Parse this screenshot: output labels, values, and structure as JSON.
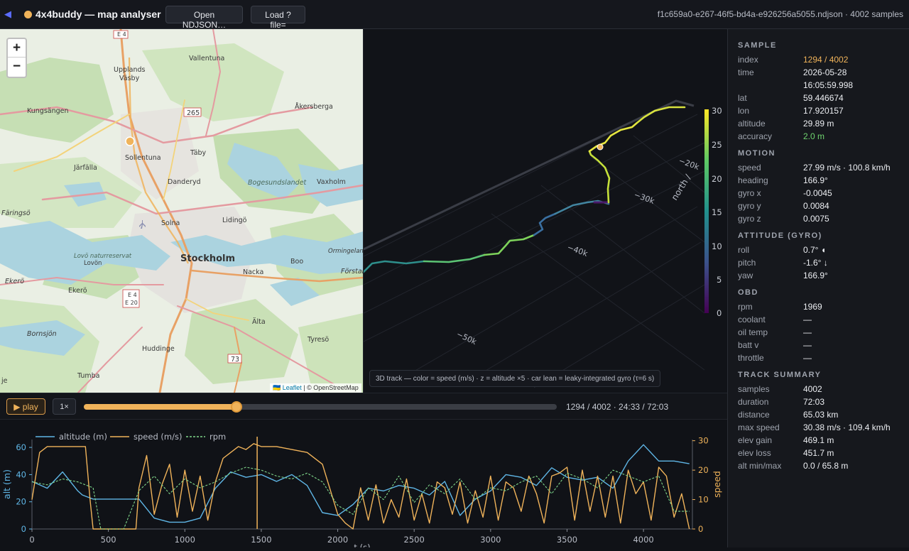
{
  "header": {
    "back_icon": "arrow-left-icon",
    "title": "4x4buddy — map analyser",
    "open_button": "Open NDJSON…",
    "load_button": "Load ?file=",
    "file_info": "f1c659a0-e267-46f5-bd4a-e926256a5055.ndjson · 4002 samples"
  },
  "map": {
    "zoom_in": "+",
    "zoom_out": "−",
    "attribution_flag": "🇺🇦",
    "attribution_link": "Leaflet",
    "attribution_text": "| © OpenStreetMap",
    "labels": [
      {
        "id": "e4-top",
        "text": "E 4"
      },
      {
        "id": "vallentuna",
        "text": "Vallentuna"
      },
      {
        "id": "upplands-vasby",
        "text": "Upplands\nVäsby"
      },
      {
        "id": "kungsangen",
        "text": "Kungsängen"
      },
      {
        "id": "r265",
        "text": "265"
      },
      {
        "id": "akersberga",
        "text": "Åkersberga"
      },
      {
        "id": "sollentuna",
        "text": "Sollentuna"
      },
      {
        "id": "taby",
        "text": "Täby"
      },
      {
        "id": "jarfalla",
        "text": "Järfälla"
      },
      {
        "id": "danderyd",
        "text": "Danderyd"
      },
      {
        "id": "bogesund",
        "text": "Bogesundslandet"
      },
      {
        "id": "vaxholm",
        "text": "Vaxholm"
      },
      {
        "id": "faringso",
        "text": "Färingsö"
      },
      {
        "id": "solna",
        "text": "Solna"
      },
      {
        "id": "lidingo",
        "text": "Lidingö"
      },
      {
        "id": "lovo-nr",
        "text": "Lovö naturreservat"
      },
      {
        "id": "lovon",
        "text": "Lovön"
      },
      {
        "id": "stockholm",
        "text": "Stockholm"
      },
      {
        "id": "ormingelandet",
        "text": "Ormingelandet"
      },
      {
        "id": "forstal",
        "text": "Förstal"
      },
      {
        "id": "nacka",
        "text": "Nacka"
      },
      {
        "id": "boo",
        "text": "Boo"
      },
      {
        "id": "ekero1",
        "text": "Ekerö"
      },
      {
        "id": "ekero2",
        "text": "Ekerö"
      },
      {
        "id": "e4e20",
        "text": "E 4\nE 20"
      },
      {
        "id": "alta",
        "text": "Älta"
      },
      {
        "id": "bornsjon",
        "text": "Bornsjön"
      },
      {
        "id": "tyreso",
        "text": "Tyresö"
      },
      {
        "id": "huddinge",
        "text": "Huddinge"
      },
      {
        "id": "r73",
        "text": "73"
      },
      {
        "id": "tumba",
        "text": "Tumba"
      },
      {
        "id": "je",
        "text": "je"
      }
    ],
    "marker_color": "#f0b35a"
  },
  "plot3d": {
    "caption": "3D track — color = speed (m/s) · z = altitude ×5 · car lean = leaky-integrated gyro (τ=6 s)",
    "north_ticks": [
      "−20k",
      "−30k",
      "−40k",
      "−50k"
    ],
    "north_label": "north /",
    "colorbar_ticks": [
      "30",
      "25",
      "20",
      "15",
      "10",
      "5",
      "0"
    ]
  },
  "playback": {
    "play_icon": "play-triangle-icon",
    "play_label": "play",
    "speed_label": "1×",
    "progress": 0.3233,
    "status": "1294 / 4002 · 24:33 / 72:03"
  },
  "chart_data": {
    "type": "line",
    "legend": [
      "altitude (m)",
      "speed (m/s)",
      "rpm"
    ],
    "xlabel": "t (s)",
    "ylabel_left": "alt (m)",
    "ylabel_right": "speed",
    "x_ticks": [
      "0",
      "500",
      "1000",
      "1500",
      "2000",
      "2500",
      "3000",
      "3500",
      "4000"
    ],
    "y_left_ticks": [
      "0",
      "20",
      "40",
      "60"
    ],
    "y_right_ticks": [
      "0",
      "10",
      "20",
      "30"
    ],
    "xlim": [
      0,
      4320
    ],
    "ylim_left": [
      0,
      65.8
    ],
    "ylim_right": [
      0,
      30.4
    ],
    "cursor_x": 1473,
    "series": [
      {
        "name": "altitude (m)",
        "color": "#5fb6e6",
        "axis": "left",
        "x": [
          0,
          100,
          200,
          300,
          330,
          400,
          450,
          500,
          600,
          700,
          800,
          900,
          1000,
          1100,
          1200,
          1300,
          1400,
          1500,
          1600,
          1700,
          1800,
          1900,
          2000,
          2100,
          2200,
          2300,
          2400,
          2500,
          2600,
          2700,
          2800,
          2900,
          3000,
          3100,
          3200,
          3300,
          3400,
          3500,
          3600,
          3700,
          3800,
          3900,
          4000,
          4100,
          4200,
          4300
        ],
        "y": [
          35,
          30,
          42,
          28,
          25,
          22,
          22,
          22,
          22,
          22,
          8,
          5,
          5,
          8,
          30,
          42,
          38,
          40,
          35,
          40,
          32,
          12,
          10,
          18,
          30,
          28,
          32,
          30,
          25,
          35,
          10,
          22,
          28,
          40,
          38,
          32,
          45,
          38,
          36,
          38,
          30,
          50,
          62,
          50,
          50,
          48
        ]
      },
      {
        "name": "speed (m/s)",
        "color": "#f0b35a",
        "axis": "right",
        "x": [
          0,
          50,
          100,
          150,
          200,
          250,
          300,
          350,
          380,
          400,
          450,
          600,
          680,
          700,
          750,
          800,
          850,
          900,
          950,
          1000,
          1050,
          1100,
          1150,
          1200,
          1250,
          1300,
          1350,
          1400,
          1450,
          1500,
          1600,
          1700,
          1800,
          1900,
          2000,
          2050,
          2100,
          2150,
          2200,
          2250,
          2300,
          2350,
          2400,
          2450,
          2500,
          2550,
          2600,
          2650,
          2700,
          2750,
          2800,
          2850,
          2900,
          2950,
          3000,
          3050,
          3100,
          3150,
          3200,
          3250,
          3300,
          3350,
          3400,
          3450,
          3500,
          3550,
          3600,
          3650,
          3700,
          3750,
          3800,
          3850,
          3900,
          3950,
          4000,
          4050,
          4100,
          4150,
          4200,
          4250,
          4300
        ],
        "y": [
          10,
          26,
          28,
          28,
          28,
          28,
          28,
          28,
          10,
          0,
          0,
          0,
          0,
          14,
          25,
          5,
          15,
          22,
          4,
          20,
          6,
          18,
          3,
          16,
          24,
          26,
          28,
          27,
          29,
          28,
          28,
          27,
          26,
          22,
          5,
          2,
          0,
          14,
          3,
          15,
          2,
          10,
          4,
          17,
          3,
          12,
          2,
          16,
          14,
          5,
          16,
          2,
          13,
          4,
          18,
          3,
          16,
          14,
          6,
          18,
          12,
          2,
          18,
          19,
          21,
          3,
          20,
          6,
          18,
          4,
          18,
          2,
          20,
          12,
          16,
          3,
          21,
          18,
          4,
          12,
          0
        ]
      },
      {
        "name": "rpm",
        "color": "#7fd68a",
        "axis": "right",
        "dashed": true,
        "x": [
          0,
          100,
          200,
          300,
          400,
          450,
          600,
          700,
          800,
          900,
          1000,
          1100,
          1200,
          1300,
          1400,
          1500,
          1600,
          1700,
          1800,
          1900,
          2000,
          2100,
          2200,
          2300,
          2400,
          2500,
          2600,
          2700,
          2800,
          2900,
          3000,
          3100,
          3200,
          3300,
          3400,
          3500,
          3600,
          3700,
          3800,
          3900,
          4000,
          4100,
          4200,
          4300
        ],
        "y": [
          16,
          15,
          17,
          16,
          14,
          0,
          0,
          13,
          18,
          12,
          17,
          14,
          16,
          19,
          21,
          20,
          18,
          17,
          19,
          16,
          8,
          5,
          14,
          10,
          18,
          9,
          15,
          12,
          17,
          10,
          14,
          13,
          16,
          18,
          12,
          19,
          17,
          14,
          20,
          18,
          16,
          18,
          6,
          6
        ]
      }
    ]
  },
  "sample": {
    "heading": "SAMPLE",
    "rows": [
      {
        "k": "index",
        "v": "1294 / 4002"
      },
      {
        "k": "time",
        "v": "2026-05-28\n16:05:59.998"
      },
      {
        "k": "lat",
        "v": "59.446674"
      },
      {
        "k": "lon",
        "v": "17.920157"
      },
      {
        "k": "altitude",
        "v": "29.89 m"
      },
      {
        "k": "accuracy",
        "v": "2.0 m"
      }
    ]
  },
  "motion": {
    "heading": "MOTION",
    "rows": [
      {
        "k": "speed",
        "v": "27.99 m/s · 100.8 km/h"
      },
      {
        "k": "heading",
        "v": "166.9°"
      },
      {
        "k": "gyro x",
        "v": "-0.0045"
      },
      {
        "k": "gyro y",
        "v": "0.0084"
      },
      {
        "k": "gyro z",
        "v": "0.0075"
      }
    ]
  },
  "attitude": {
    "heading": "ATTITUDE (GYRO)",
    "rows": [
      {
        "k": "roll",
        "v": "0.7° ◖"
      },
      {
        "k": "pitch",
        "v": "-1.6° ↓"
      },
      {
        "k": "yaw",
        "v": "166.9°"
      }
    ]
  },
  "obd": {
    "heading": "OBD",
    "rows": [
      {
        "k": "rpm",
        "v": "1969"
      },
      {
        "k": "coolant",
        "v": "—"
      },
      {
        "k": "oil temp",
        "v": "—"
      },
      {
        "k": "batt v",
        "v": "—"
      },
      {
        "k": "throttle",
        "v": "—"
      }
    ]
  },
  "summary": {
    "heading": "TRACK SUMMARY",
    "rows": [
      {
        "k": "samples",
        "v": "4002"
      },
      {
        "k": "duration",
        "v": "72:03"
      },
      {
        "k": "distance",
        "v": "65.03 km"
      },
      {
        "k": "max speed",
        "v": "30.38 m/s · 109.4 km/h"
      },
      {
        "k": "elev gain",
        "v": "469.1 m"
      },
      {
        "k": "elev loss",
        "v": "451.7 m"
      },
      {
        "k": "alt min/max",
        "v": "0.0 / 65.8 m"
      }
    ]
  },
  "colors": {
    "accent": "#f0b35a",
    "good": "#6fd36f",
    "altitude": "#5fb6e6",
    "rpm": "#7fd68a"
  }
}
